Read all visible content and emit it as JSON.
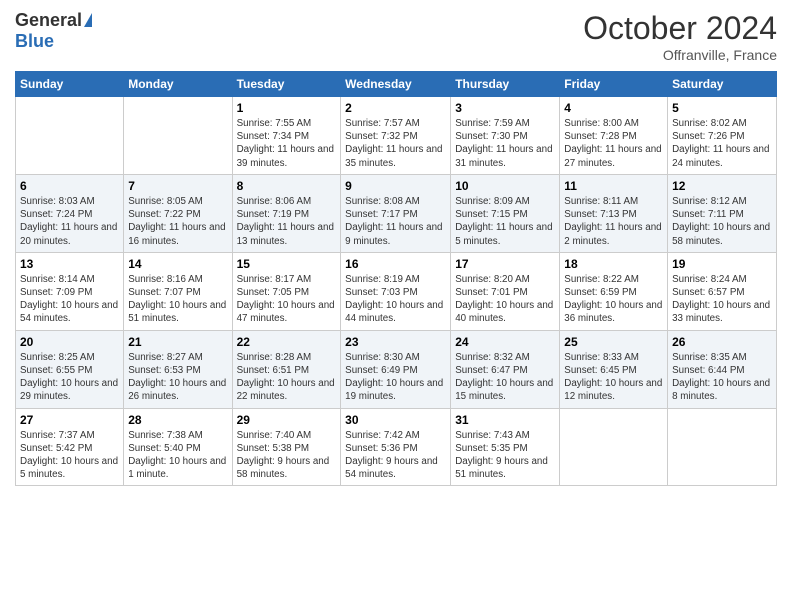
{
  "header": {
    "logo_general": "General",
    "logo_blue": "Blue",
    "month_title": "October 2024",
    "location": "Offranville, France"
  },
  "days_of_week": [
    "Sunday",
    "Monday",
    "Tuesday",
    "Wednesday",
    "Thursday",
    "Friday",
    "Saturday"
  ],
  "weeks": [
    [
      null,
      null,
      {
        "day": 1,
        "sunrise": "Sunrise: 7:55 AM",
        "sunset": "Sunset: 7:34 PM",
        "daylight": "Daylight: 11 hours and 39 minutes."
      },
      {
        "day": 2,
        "sunrise": "Sunrise: 7:57 AM",
        "sunset": "Sunset: 7:32 PM",
        "daylight": "Daylight: 11 hours and 35 minutes."
      },
      {
        "day": 3,
        "sunrise": "Sunrise: 7:59 AM",
        "sunset": "Sunset: 7:30 PM",
        "daylight": "Daylight: 11 hours and 31 minutes."
      },
      {
        "day": 4,
        "sunrise": "Sunrise: 8:00 AM",
        "sunset": "Sunset: 7:28 PM",
        "daylight": "Daylight: 11 hours and 27 minutes."
      },
      {
        "day": 5,
        "sunrise": "Sunrise: 8:02 AM",
        "sunset": "Sunset: 7:26 PM",
        "daylight": "Daylight: 11 hours and 24 minutes."
      }
    ],
    [
      {
        "day": 6,
        "sunrise": "Sunrise: 8:03 AM",
        "sunset": "Sunset: 7:24 PM",
        "daylight": "Daylight: 11 hours and 20 minutes."
      },
      {
        "day": 7,
        "sunrise": "Sunrise: 8:05 AM",
        "sunset": "Sunset: 7:22 PM",
        "daylight": "Daylight: 11 hours and 16 minutes."
      },
      {
        "day": 8,
        "sunrise": "Sunrise: 8:06 AM",
        "sunset": "Sunset: 7:19 PM",
        "daylight": "Daylight: 11 hours and 13 minutes."
      },
      {
        "day": 9,
        "sunrise": "Sunrise: 8:08 AM",
        "sunset": "Sunset: 7:17 PM",
        "daylight": "Daylight: 11 hours and 9 minutes."
      },
      {
        "day": 10,
        "sunrise": "Sunrise: 8:09 AM",
        "sunset": "Sunset: 7:15 PM",
        "daylight": "Daylight: 11 hours and 5 minutes."
      },
      {
        "day": 11,
        "sunrise": "Sunrise: 8:11 AM",
        "sunset": "Sunset: 7:13 PM",
        "daylight": "Daylight: 11 hours and 2 minutes."
      },
      {
        "day": 12,
        "sunrise": "Sunrise: 8:12 AM",
        "sunset": "Sunset: 7:11 PM",
        "daylight": "Daylight: 10 hours and 58 minutes."
      }
    ],
    [
      {
        "day": 13,
        "sunrise": "Sunrise: 8:14 AM",
        "sunset": "Sunset: 7:09 PM",
        "daylight": "Daylight: 10 hours and 54 minutes."
      },
      {
        "day": 14,
        "sunrise": "Sunrise: 8:16 AM",
        "sunset": "Sunset: 7:07 PM",
        "daylight": "Daylight: 10 hours and 51 minutes."
      },
      {
        "day": 15,
        "sunrise": "Sunrise: 8:17 AM",
        "sunset": "Sunset: 7:05 PM",
        "daylight": "Daylight: 10 hours and 47 minutes."
      },
      {
        "day": 16,
        "sunrise": "Sunrise: 8:19 AM",
        "sunset": "Sunset: 7:03 PM",
        "daylight": "Daylight: 10 hours and 44 minutes."
      },
      {
        "day": 17,
        "sunrise": "Sunrise: 8:20 AM",
        "sunset": "Sunset: 7:01 PM",
        "daylight": "Daylight: 10 hours and 40 minutes."
      },
      {
        "day": 18,
        "sunrise": "Sunrise: 8:22 AM",
        "sunset": "Sunset: 6:59 PM",
        "daylight": "Daylight: 10 hours and 36 minutes."
      },
      {
        "day": 19,
        "sunrise": "Sunrise: 8:24 AM",
        "sunset": "Sunset: 6:57 PM",
        "daylight": "Daylight: 10 hours and 33 minutes."
      }
    ],
    [
      {
        "day": 20,
        "sunrise": "Sunrise: 8:25 AM",
        "sunset": "Sunset: 6:55 PM",
        "daylight": "Daylight: 10 hours and 29 minutes."
      },
      {
        "day": 21,
        "sunrise": "Sunrise: 8:27 AM",
        "sunset": "Sunset: 6:53 PM",
        "daylight": "Daylight: 10 hours and 26 minutes."
      },
      {
        "day": 22,
        "sunrise": "Sunrise: 8:28 AM",
        "sunset": "Sunset: 6:51 PM",
        "daylight": "Daylight: 10 hours and 22 minutes."
      },
      {
        "day": 23,
        "sunrise": "Sunrise: 8:30 AM",
        "sunset": "Sunset: 6:49 PM",
        "daylight": "Daylight: 10 hours and 19 minutes."
      },
      {
        "day": 24,
        "sunrise": "Sunrise: 8:32 AM",
        "sunset": "Sunset: 6:47 PM",
        "daylight": "Daylight: 10 hours and 15 minutes."
      },
      {
        "day": 25,
        "sunrise": "Sunrise: 8:33 AM",
        "sunset": "Sunset: 6:45 PM",
        "daylight": "Daylight: 10 hours and 12 minutes."
      },
      {
        "day": 26,
        "sunrise": "Sunrise: 8:35 AM",
        "sunset": "Sunset: 6:44 PM",
        "daylight": "Daylight: 10 hours and 8 minutes."
      }
    ],
    [
      {
        "day": 27,
        "sunrise": "Sunrise: 7:37 AM",
        "sunset": "Sunset: 5:42 PM",
        "daylight": "Daylight: 10 hours and 5 minutes."
      },
      {
        "day": 28,
        "sunrise": "Sunrise: 7:38 AM",
        "sunset": "Sunset: 5:40 PM",
        "daylight": "Daylight: 10 hours and 1 minute."
      },
      {
        "day": 29,
        "sunrise": "Sunrise: 7:40 AM",
        "sunset": "Sunset: 5:38 PM",
        "daylight": "Daylight: 9 hours and 58 minutes."
      },
      {
        "day": 30,
        "sunrise": "Sunrise: 7:42 AM",
        "sunset": "Sunset: 5:36 PM",
        "daylight": "Daylight: 9 hours and 54 minutes."
      },
      {
        "day": 31,
        "sunrise": "Sunrise: 7:43 AM",
        "sunset": "Sunset: 5:35 PM",
        "daylight": "Daylight: 9 hours and 51 minutes."
      },
      null,
      null
    ]
  ]
}
